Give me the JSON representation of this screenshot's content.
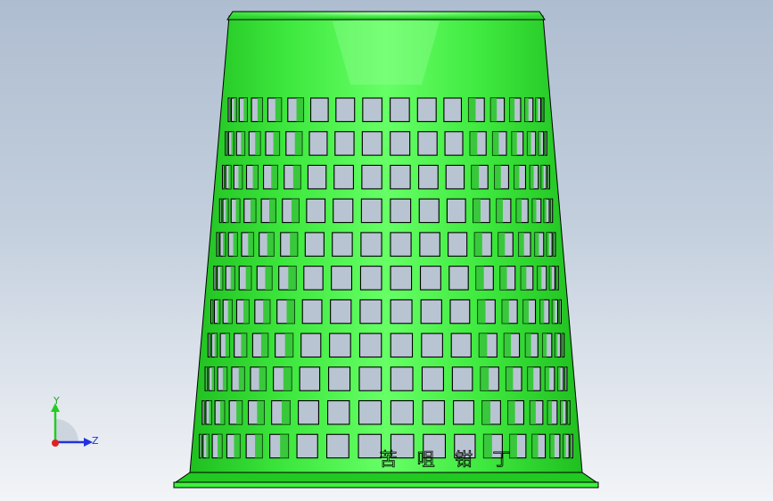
{
  "viewport": {
    "background_top": "#aebdd0",
    "background_bottom": "#f2f4f7"
  },
  "model": {
    "body_color": "#3df23d",
    "body_shade": "#22c922",
    "highlight_color": "#9cff9c",
    "hole_color": "#b9c4d2",
    "outline_color": "#000000",
    "rows": 11,
    "columns": 18,
    "bottom_text": "苦 咀 钳 丁"
  },
  "triad": {
    "y_label": "Y",
    "z_label": "Z",
    "y_color": "#22cc22",
    "z_color": "#2233dd",
    "x_color": "#dd2222",
    "icon": "coordinate-triad-icon"
  }
}
